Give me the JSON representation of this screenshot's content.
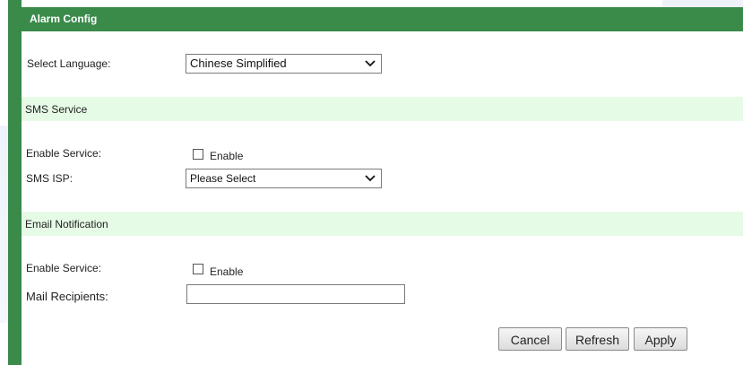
{
  "header": {
    "title": "Alarm Config"
  },
  "language": {
    "label": "Select Language:",
    "selected": "Chinese Simplified"
  },
  "sms": {
    "section_title": "SMS Service",
    "enable_label": "Enable Service:",
    "enable_checkbox_label": "Enable",
    "enabled": false,
    "isp_label": "SMS ISP:",
    "isp_selected": "Please Select"
  },
  "email": {
    "section_title": "Email Notification",
    "enable_label": "Enable Service:",
    "enable_checkbox_label": "Enable",
    "enabled": false,
    "recipients_label": "Mail Recipients:",
    "recipients_value": ""
  },
  "actions": {
    "cancel_label": "Cancel",
    "refresh_label": "Refresh",
    "apply_label": "Apply"
  },
  "colors": {
    "accent_green": "#3a8a4a",
    "section_band": "#e6fbe6"
  },
  "icons": {
    "dropdown": "chevron-down-icon"
  }
}
